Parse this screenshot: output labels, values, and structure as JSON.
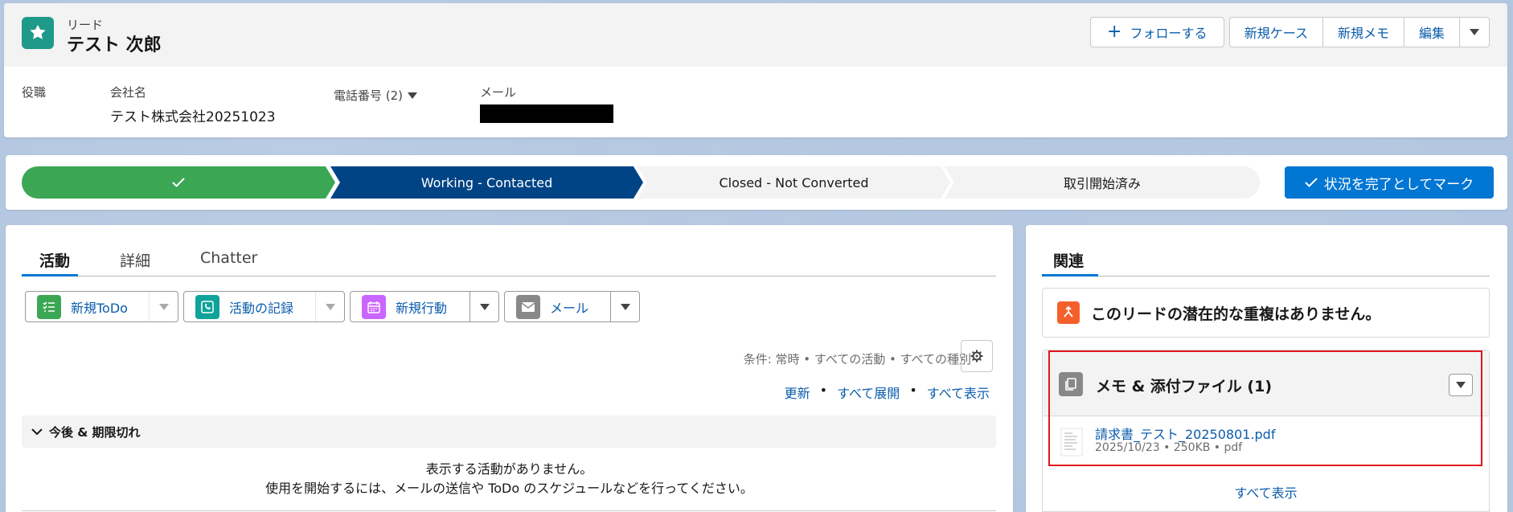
{
  "header": {
    "object_label": "リード",
    "record_name": "テスト 次郎",
    "actions": {
      "follow": "フォローする",
      "new_case": "新規ケース",
      "new_memo": "新規メモ",
      "edit": "編集"
    },
    "fields": {
      "title_label": "役職",
      "company_label": "会社名",
      "company_value": "テスト株式会社20251023",
      "phone_label": "電話番号 (2)",
      "email_label": "メール"
    }
  },
  "path": {
    "stages": [
      "",
      "Working - Contacted",
      "Closed - Not Converted",
      "取引開始済み"
    ],
    "current_index": 1,
    "mark_button": "状況を完了としてマーク"
  },
  "activity": {
    "tabs": [
      "活動",
      "詳細",
      "Chatter"
    ],
    "publishers": {
      "todo": "新規ToDo",
      "log": "活動の記録",
      "event": "新規行動",
      "email": "メール"
    },
    "filter_text": "条件: 常時 • すべての活動 • すべての種別",
    "links": {
      "refresh": "更新",
      "expand_all": "すべて展開",
      "view_all": "すべて表示",
      "separator": "•"
    },
    "upcoming_title": "今後 & 期限切れ",
    "empty_line1": "表示する活動がありません。",
    "empty_line2": "使用を開始するには、メールの送信や ToDo のスケジュールなどを行ってください。"
  },
  "related": {
    "tab": "関連",
    "duplicates_text": "このリードの潜在的な重複はありません。",
    "notes_title": "メモ & 添付ファイル (1)",
    "file_name": "請求書_テスト_20250801.pdf",
    "file_meta": "2025/10/23 • 250KB • pdf",
    "view_all": "すべて表示"
  },
  "colors": {
    "brand_blue": "#0176d3",
    "path_complete": "#3ba755",
    "path_current": "#014486",
    "highlight_red": "#e0141e",
    "lead_icon": "#1f9a8a"
  }
}
